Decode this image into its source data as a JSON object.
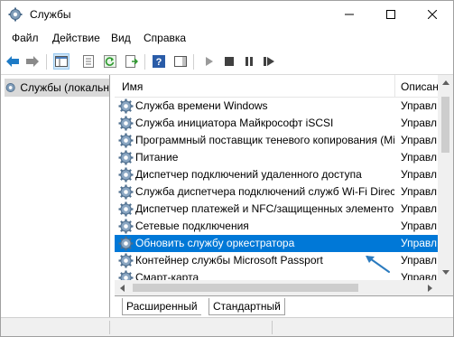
{
  "window": {
    "title": "Службы",
    "app_icon": "services-gear-icon",
    "controls": [
      "minimize-icon",
      "maximize-icon",
      "close-icon"
    ]
  },
  "menu": {
    "items": [
      "Файл",
      "Действие",
      "Вид",
      "Справка"
    ]
  },
  "toolbar": {
    "buttons": [
      "back-arrow-icon",
      "forward-arrow-icon",
      "show-hide-console-tree-icon",
      "properties-icon",
      "refresh-icon",
      "export-list-icon",
      "help-icon",
      "action-pane-icon",
      "start-service-icon",
      "stop-service-icon",
      "pause-service-icon",
      "restart-service-icon"
    ]
  },
  "tree": {
    "item_label": "Службы (локальн"
  },
  "services_list": {
    "columns": {
      "name": "Имя",
      "description": "Описан"
    },
    "rows": [
      {
        "name": "Служба времени Windows",
        "description": "Управл"
      },
      {
        "name": "Служба инициатора Майкрософт iSCSI",
        "description": "Управл"
      },
      {
        "name": "Программный поставщик теневого копирования (Microsoft)",
        "description": "Управл"
      },
      {
        "name": "Питание",
        "description": "Управл"
      },
      {
        "name": "Диспетчер подключений удаленного доступа",
        "description": "Управл"
      },
      {
        "name": "Служба диспетчера подключений служб Wi-Fi Direct",
        "description": "Управл"
      },
      {
        "name": "Диспетчер платежей и NFC/защищенных элементов",
        "description": "Управл"
      },
      {
        "name": "Сетевые подключения",
        "description": "Управл"
      },
      {
        "name": "Обновить службу оркестратора",
        "description": "Управл",
        "selected": true
      },
      {
        "name": "Контейнер службы Microsoft Passport",
        "description": "Управл"
      },
      {
        "name": "Смарт-карта",
        "description": "Управл"
      }
    ],
    "selection_color": "#0078d7",
    "annotation_arrow_color": "#2b7bbf"
  },
  "tabs": {
    "extended": "Расширенный",
    "standard": "Стандартный"
  }
}
